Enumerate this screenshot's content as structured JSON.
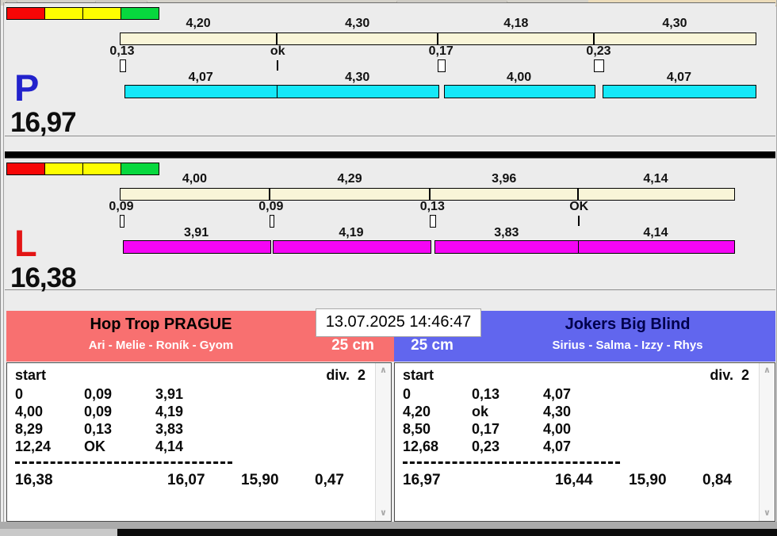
{
  "chrome": {
    "datetime": "13.07.2025 14:46:47"
  },
  "lanes": [
    {
      "letter": "P",
      "letter_color": "#2222cc",
      "total": "16,97",
      "bar_color": "#15e8f8",
      "lights": [
        "#f70606",
        "#fdfd00",
        "#fdfd00",
        "#07d83e"
      ],
      "splits": [
        {
          "label": "4,20",
          "seconds": 4.2
        },
        {
          "label": "4,30",
          "seconds": 4.3
        },
        {
          "label": "4,18",
          "seconds": 4.18
        },
        {
          "label": "4,30",
          "seconds": 4.3
        }
      ],
      "changeovers": [
        {
          "label": "0,13",
          "loss": 0.13,
          "ok": false
        },
        {
          "label": "ok",
          "loss": 0,
          "ok": true
        },
        {
          "label": "0,17",
          "loss": 0.17,
          "ok": false
        },
        {
          "label": "0,23",
          "loss": 0.23,
          "ok": false
        }
      ],
      "dogs": [
        {
          "label": "4,07",
          "seconds": 4.07
        },
        {
          "label": "4,30",
          "seconds": 4.3
        },
        {
          "label": "4,00",
          "seconds": 4.0
        },
        {
          "label": "4,07",
          "seconds": 4.07
        }
      ]
    },
    {
      "letter": "L",
      "letter_color": "#e31515",
      "total": "16,38",
      "bar_color": "#f505f5",
      "lights": [
        "#f70606",
        "#fdfd00",
        "#fdfd00",
        "#07d83e"
      ],
      "splits": [
        {
          "label": "4,00",
          "seconds": 4.0
        },
        {
          "label": "4,29",
          "seconds": 4.29
        },
        {
          "label": "3,96",
          "seconds": 3.96
        },
        {
          "label": "4,14",
          "seconds": 4.14
        }
      ],
      "changeovers": [
        {
          "label": "0,09",
          "loss": 0.09,
          "ok": false
        },
        {
          "label": "0,09",
          "loss": 0.09,
          "ok": false
        },
        {
          "label": "0,13",
          "loss": 0.13,
          "ok": false
        },
        {
          "label": "OK",
          "loss": 0,
          "ok": true
        }
      ],
      "dogs": [
        {
          "label": "3,91",
          "seconds": 3.91
        },
        {
          "label": "4,19",
          "seconds": 4.19
        },
        {
          "label": "3,83",
          "seconds": 3.83
        },
        {
          "label": "4,14",
          "seconds": 4.14
        }
      ]
    }
  ],
  "teams": [
    {
      "name": "Hop Trop PRAGUE",
      "name_color": "#000000",
      "bg": "#f87070",
      "members": "Ari - Melie - Roník - Gyom",
      "jump_height": "25 cm",
      "table": {
        "start_label": "start",
        "division_label": "div.  2",
        "rows": [
          [
            "0",
            "0,09",
            "3,91"
          ],
          [
            "4,00",
            "0,09",
            "4,19"
          ],
          [
            "8,29",
            "0,13",
            "3,83"
          ],
          [
            "12,24",
            "OK",
            "4,14"
          ]
        ],
        "totals": [
          "16,38",
          "16,07",
          "15,90",
          "0,47"
        ]
      }
    },
    {
      "name": "Jokers Big Blind",
      "name_color": "#00004c",
      "bg": "#6166ee",
      "members": "Sirius - Salma - Izzy - Rhys",
      "jump_height": "25 cm",
      "table": {
        "start_label": "start",
        "division_label": "div.  2",
        "rows": [
          [
            "0",
            "0,13",
            "4,07"
          ],
          [
            "4,20",
            "ok",
            "4,30"
          ],
          [
            "8,50",
            "0,17",
            "4,00"
          ],
          [
            "12,68",
            "0,23",
            "4,07"
          ]
        ],
        "totals": [
          "16,97",
          "16,44",
          "15,90",
          "0,84"
        ]
      }
    }
  ]
}
